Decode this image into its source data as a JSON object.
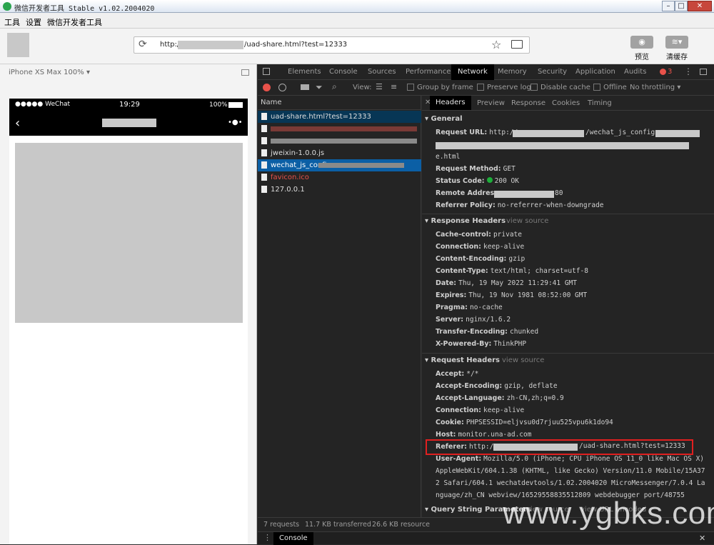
{
  "window": {
    "title": "微信开发者工具 Stable v1.02.2004020"
  },
  "menu": [
    "工具",
    "设置",
    "微信开发者工具"
  ],
  "toolbar": {
    "url_prefix": "http://",
    "url_suffix": "/uad-share.html?test=12333",
    "preview_label": "预览",
    "clear_cache_label": "清缓存"
  },
  "simulator": {
    "device_label": "iPhone XS Max 100%",
    "carrier": "●●●●● WeChat",
    "time": "19:29",
    "battery": "100%",
    "more": "•●•"
  },
  "devtools": {
    "tabs": [
      "Elements",
      "Console",
      "Sources",
      "Performance",
      "Network",
      "Memory",
      "Security",
      "Application",
      "Audits"
    ],
    "active_tab": "Network",
    "error_count": "3",
    "toolbar": {
      "view_label": "View:",
      "group_by_frame": "Group by frame",
      "preserve_log": "Preserve log",
      "disable_cache": "Disable cache",
      "offline": "Offline",
      "throttling": "No throttling"
    },
    "name_header": "Name",
    "requests": [
      {
        "name": "uad-share.html?test=12333",
        "state": "selected",
        "color": "#dddddd"
      },
      {
        "name": "",
        "state": "error",
        "color": "#e8524a"
      },
      {
        "name": "",
        "state": "normal",
        "color": "#dddddd"
      },
      {
        "name": "jweixin-1.0.0.js",
        "state": "normal",
        "color": "#dddddd"
      },
      {
        "name": "wechat_js_confi",
        "state": "highlight",
        "color": "#ffffff"
      },
      {
        "name": "favicon.ico",
        "state": "error",
        "color": "#e8524a"
      },
      {
        "name": "127.0.0.1",
        "state": "normal",
        "color": "#dddddd"
      }
    ],
    "detail_tabs": [
      "Headers",
      "Preview",
      "Response",
      "Cookies",
      "Timing"
    ],
    "active_detail_tab": "Headers",
    "general": {
      "title": "General",
      "rows": [
        {
          "k": "Request URL:",
          "v": "http://"
        },
        {
          "k": "",
          "v": "e.html"
        },
        {
          "k": "Request Method:",
          "v": "GET"
        },
        {
          "k": "Status Code:",
          "v": "200 OK"
        },
        {
          "k": "Remote Address:",
          "v": "80"
        },
        {
          "k": "Referrer Policy:",
          "v": "no-referrer-when-downgrade"
        }
      ],
      "url_fragment": "/wechat_js_config"
    },
    "response_headers": {
      "title": "Response Headers",
      "view_source": "view source",
      "rows": [
        {
          "k": "Cache-control:",
          "v": "private"
        },
        {
          "k": "Connection:",
          "v": "keep-alive"
        },
        {
          "k": "Content-Encoding:",
          "v": "gzip"
        },
        {
          "k": "Content-Type:",
          "v": "text/html; charset=utf-8"
        },
        {
          "k": "Date:",
          "v": "Thu, 19 May 2022 11:29:41 GMT"
        },
        {
          "k": "Expires:",
          "v": "Thu, 19 Nov 1981 08:52:00 GMT"
        },
        {
          "k": "Pragma:",
          "v": "no-cache"
        },
        {
          "k": "Server:",
          "v": "nginx/1.6.2"
        },
        {
          "k": "Transfer-Encoding:",
          "v": "chunked"
        },
        {
          "k": "X-Powered-By:",
          "v": "ThinkPHP"
        }
      ]
    },
    "request_headers": {
      "title": "Request Headers",
      "view_source": "view source",
      "rows": [
        {
          "k": "Accept:",
          "v": "*/*"
        },
        {
          "k": "Accept-Encoding:",
          "v": "gzip, deflate"
        },
        {
          "k": "Accept-Language:",
          "v": "zh-CN,zh;q=0.9"
        },
        {
          "k": "Connection:",
          "v": "keep-alive"
        },
        {
          "k": "Cookie:",
          "v": "PHPSESSID=eljvsu0d7rjuu525vpu6k1do94"
        },
        {
          "k": "Host:",
          "v": "monitor.una-ad.com"
        },
        {
          "k": "Referer:",
          "v": "http://"
        },
        {
          "k": "User-Agent:",
          "v": "Mozilla/5.0 (iPhone; CPU iPhone OS 11_0 like Mac OS X)"
        },
        {
          "k": "",
          "v": "AppleWebKit/604.1.38 (KHTML, like Gecko) Version/11.0 Mobile/15A37"
        },
        {
          "k": "",
          "v": "2 Safari/604.1 wechatdevtools/1.02.2004020 MicroMessenger/7.0.4 La"
        },
        {
          "k": "",
          "v": "nguage/zh_CN webview/16529558835512809 webdebugger port/48755"
        }
      ],
      "referer_suffix": "/uad-share.html?test=12333"
    },
    "query_string": {
      "title": "Query String Parameters",
      "view_source": "view source",
      "view_url": "view URL encoded"
    },
    "footer": [
      "7 requests",
      "11.7 KB transferred",
      "26.6 KB resource"
    ],
    "drawer_tab": "Console"
  },
  "watermark": "www.ygbks.com",
  "colors": {
    "status_ok": "#1dae3a",
    "error_red": "#e8524a",
    "highlight_box": "#e02020",
    "selected_row": "#073655",
    "highlight_row": "#0b5fa5"
  }
}
